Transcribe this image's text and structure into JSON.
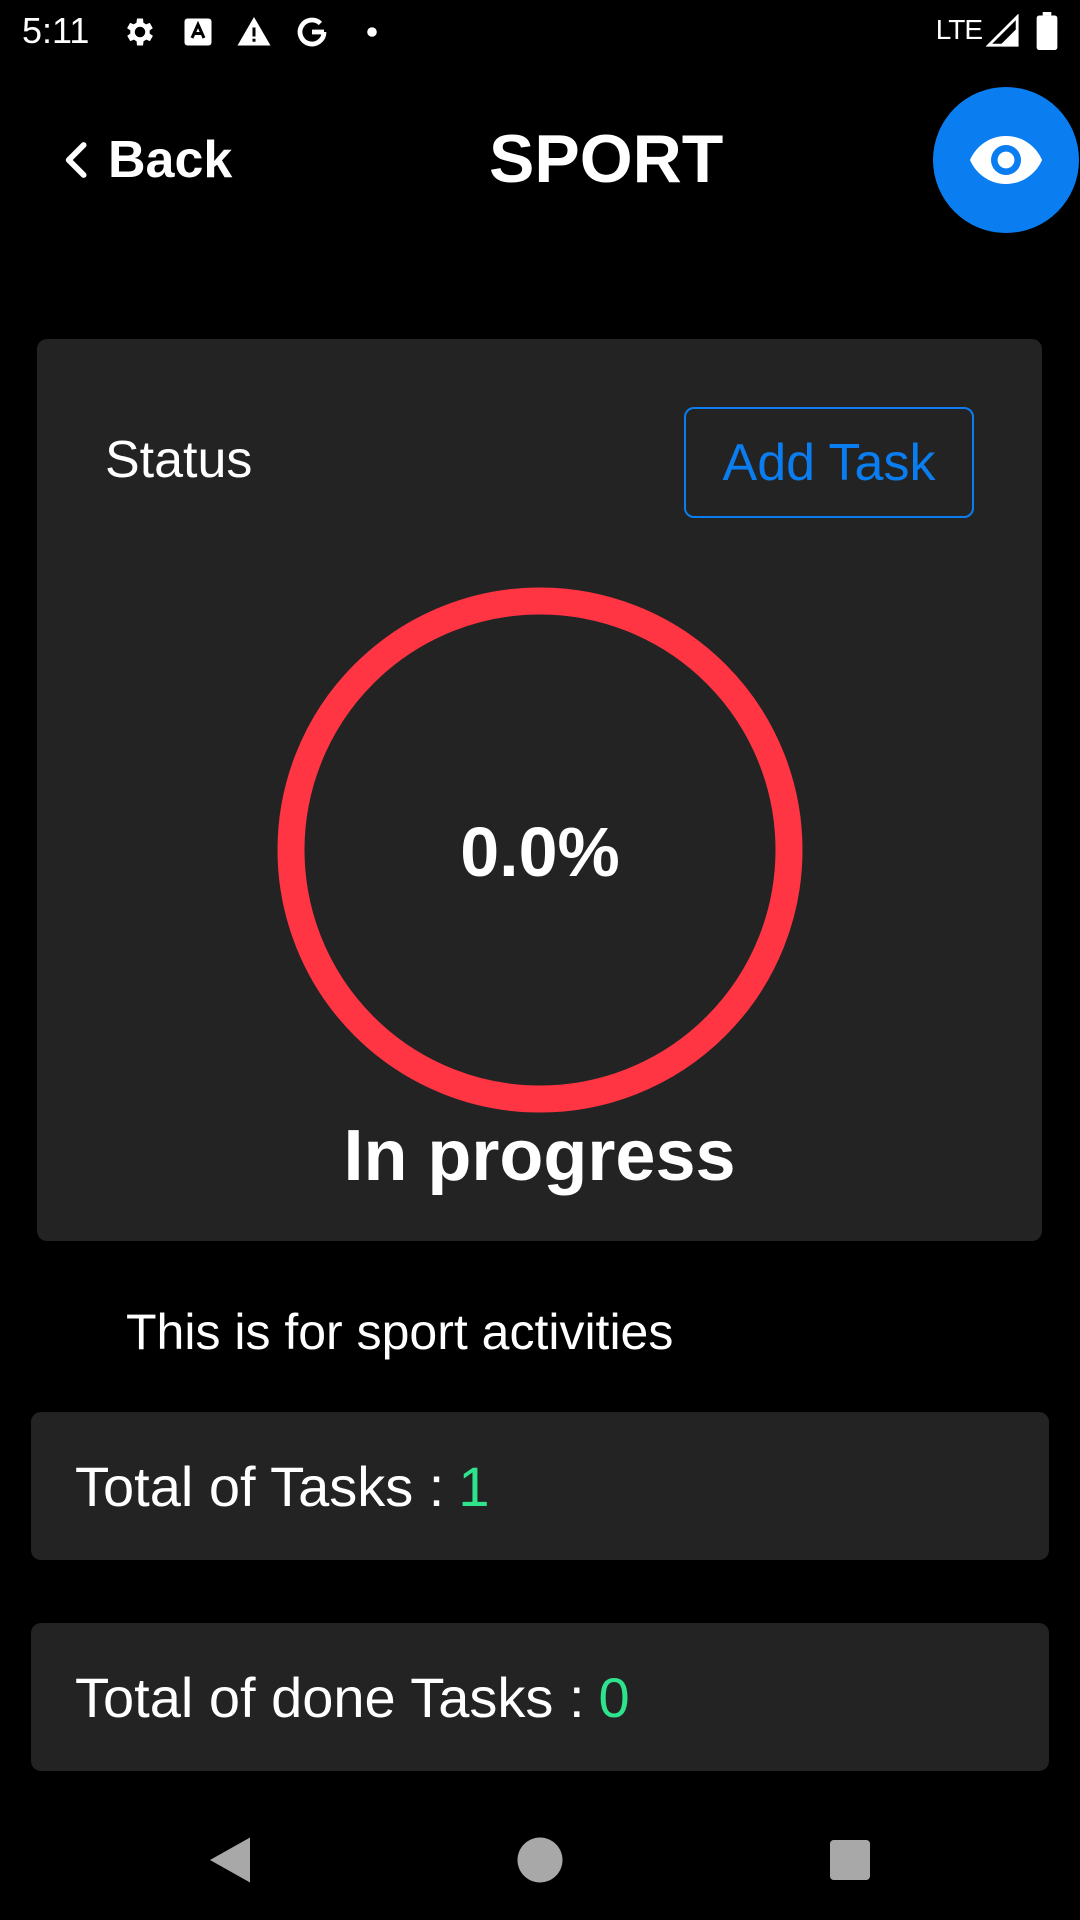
{
  "status_bar": {
    "time": "5:11",
    "network": "LTE",
    "icons": [
      "gear-icon",
      "font-a-icon",
      "warning-icon",
      "google-g-icon",
      "dot-icon",
      "signal-icon",
      "battery-icon"
    ]
  },
  "header": {
    "back_label": "Back",
    "title": "SPORT",
    "fab_icon": "eye-icon"
  },
  "status_card": {
    "label": "Status",
    "add_task_label": "Add Task",
    "progress_text": "0.0%",
    "progress_fraction": 0.0,
    "state_text": "In progress",
    "ring_color": "#ff3543"
  },
  "description": "This is for sport activities",
  "stats": {
    "total_label": "Total of Tasks :",
    "total_value": "1",
    "done_label": "Total of done Tasks :",
    "done_value": "0"
  },
  "colors": {
    "accent": "#0a7df0",
    "card_bg": "#232323",
    "value_green": "#2fe38d"
  },
  "nav_bar": {
    "icons": [
      "back-triangle-icon",
      "home-circle-icon",
      "recents-square-icon"
    ]
  }
}
